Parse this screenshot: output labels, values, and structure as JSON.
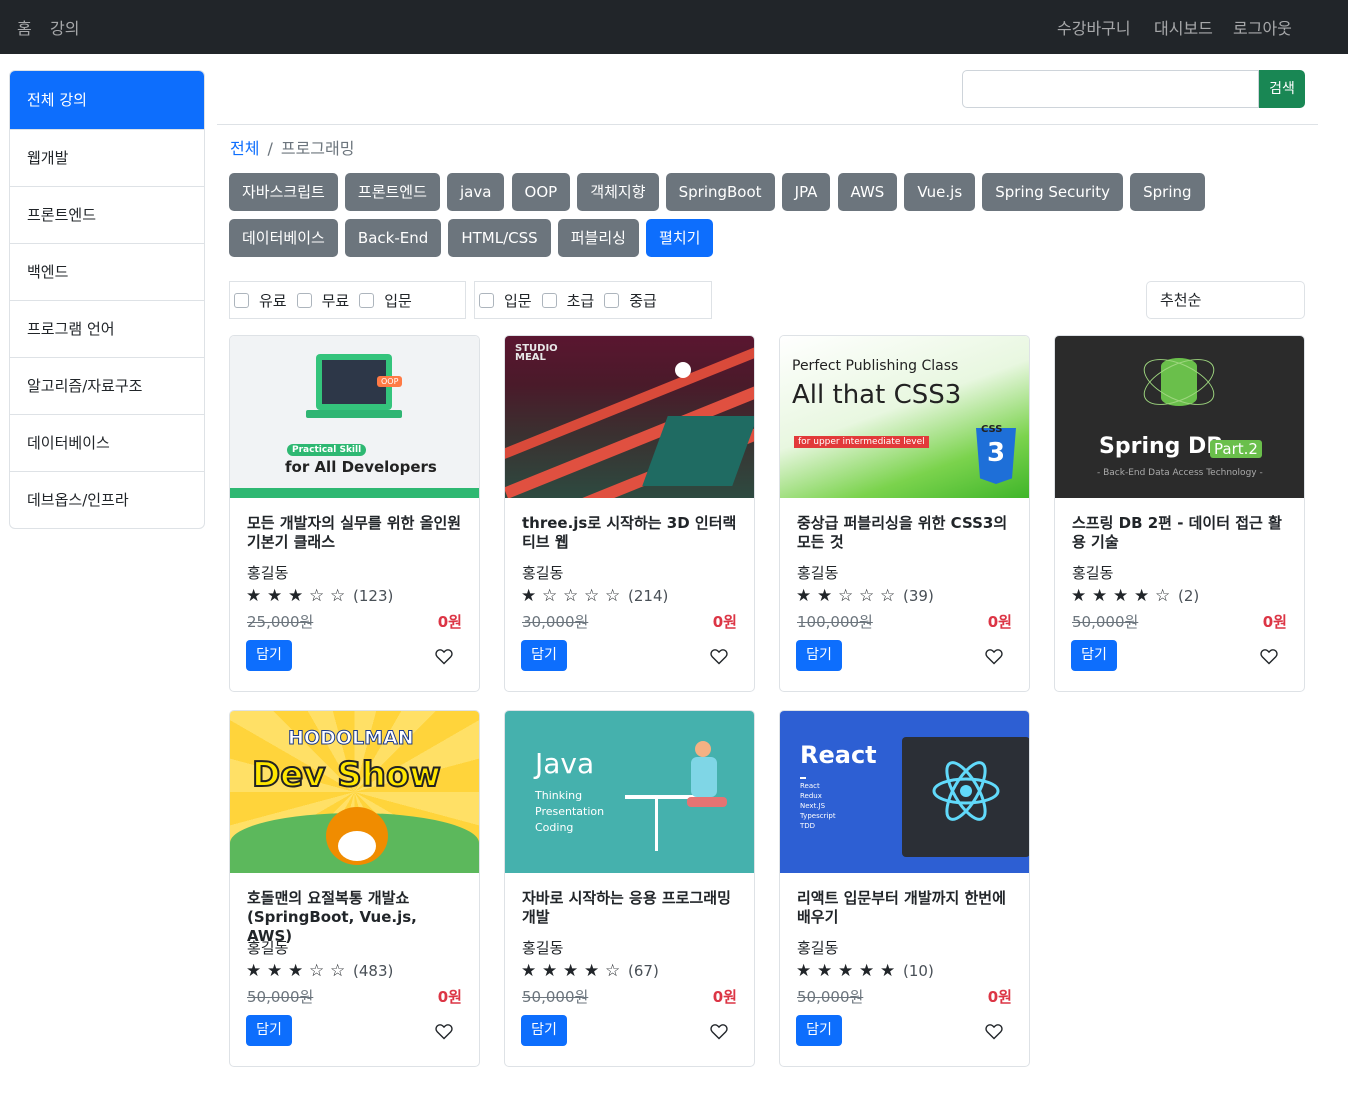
{
  "nav": {
    "left": [
      "홈",
      "강의"
    ],
    "right": [
      "수강바구니",
      "대시보드",
      "로그아웃"
    ]
  },
  "sidebar": {
    "items": [
      {
        "label": "전체 강의",
        "active": true
      },
      {
        "label": "웹개발"
      },
      {
        "label": "프론트엔드"
      },
      {
        "label": "백엔드"
      },
      {
        "label": "프로그램 언어"
      },
      {
        "label": "알고리즘/자료구조"
      },
      {
        "label": "데이터베이스"
      },
      {
        "label": "데브옵스/인프라"
      }
    ]
  },
  "search": {
    "value": "",
    "button_label": "검색"
  },
  "breadcrumb": {
    "root": "전체",
    "separator": "/",
    "current": "프로그래밍"
  },
  "tags": [
    "자바스크립트",
    "프론트엔드",
    "java",
    "OOP",
    "객체지향",
    "SpringBoot",
    "JPA",
    "AWS",
    "Vue.js",
    "Spring Security",
    "Spring",
    "데이터베이스",
    "Back-End",
    "HTML/CSS",
    "퍼블리싱"
  ],
  "expand_label": "펼치기",
  "filters": {
    "group1": [
      "유료",
      "무료",
      "입문"
    ],
    "group2": [
      "입문",
      "초급",
      "중급"
    ]
  },
  "sort": {
    "selected": "추천순"
  },
  "colors": {
    "primary": "#0d6efd",
    "secondary": "#6c757d",
    "success": "#198754",
    "danger": "#dc3545",
    "dark": "#212529"
  },
  "courses": [
    {
      "title": "모든 개발자의 실무를 위한 올인원 기본기 클래스",
      "instructor": "홍길동",
      "rating": 3,
      "count": "(123)",
      "original_price": "25,000원",
      "price": "0원",
      "cart_label": "담기",
      "thumb": {
        "kind": "practical",
        "line1": "Practical Skill",
        "line2": "for All Developers",
        "badge": "OOP"
      }
    },
    {
      "title": "three.js로 시작하는 3D 인터랙티브 웹",
      "instructor": "홍길동",
      "rating": 1,
      "count": "(214)",
      "original_price": "30,000원",
      "price": "0원",
      "cart_label": "담기",
      "thumb": {
        "kind": "three",
        "line1": "STUDIO",
        "line2": "MEAL"
      }
    },
    {
      "title": "중상급 퍼블리싱을 위한 CSS3의 모든 것",
      "instructor": "홍길동",
      "rating": 2,
      "count": "(39)",
      "original_price": "100,000원",
      "price": "0원",
      "cart_label": "담기",
      "thumb": {
        "kind": "css",
        "line1": "Perfect Publishing Class",
        "line2": "All that CSS3",
        "line3": "for upper intermediate level",
        "badge": "CSS"
      }
    },
    {
      "title": "스프링 DB 2편 - 데이터 접근 활용 기술",
      "instructor": "홍길동",
      "rating": 4,
      "count": "(2)",
      "original_price": "50,000원",
      "price": "0원",
      "cart_label": "담기",
      "thumb": {
        "kind": "springdb",
        "line1": "Spring DB",
        "line2": "Part.2",
        "line3": "- Back-End Data Access Technology -"
      }
    },
    {
      "title": "호돌맨의 요절복통 개발쇼 (SpringBoot, Vue.js, AWS)",
      "instructor": "홍길동",
      "rating": 3,
      "count": "(483)",
      "original_price": "50,000원",
      "price": "0원",
      "cart_label": "담기",
      "thumb": {
        "kind": "hodol",
        "line1": "HODOLMAN",
        "line2": "Dev Show"
      }
    },
    {
      "title": "자바로 시작하는 응용 프로그래밍 개발",
      "instructor": "홍길동",
      "rating": 4,
      "count": "(67)",
      "original_price": "50,000원",
      "price": "0원",
      "cart_label": "담기",
      "thumb": {
        "kind": "java",
        "line1": "Java",
        "line2": "Thinking",
        "line3": "Presentation",
        "line4": "Coding"
      }
    },
    {
      "title": "리액트 입문부터 개발까지 한번에 배우기",
      "instructor": "홍길동",
      "rating": 5,
      "count": "(10)",
      "original_price": "50,000원",
      "price": "0원",
      "cart_label": "담기",
      "thumb": {
        "kind": "react",
        "line1": "React",
        "line2": "React",
        "line3": "Redux",
        "line4": "Next.JS",
        "line5": "Typescript",
        "line6": "TDD"
      }
    }
  ]
}
